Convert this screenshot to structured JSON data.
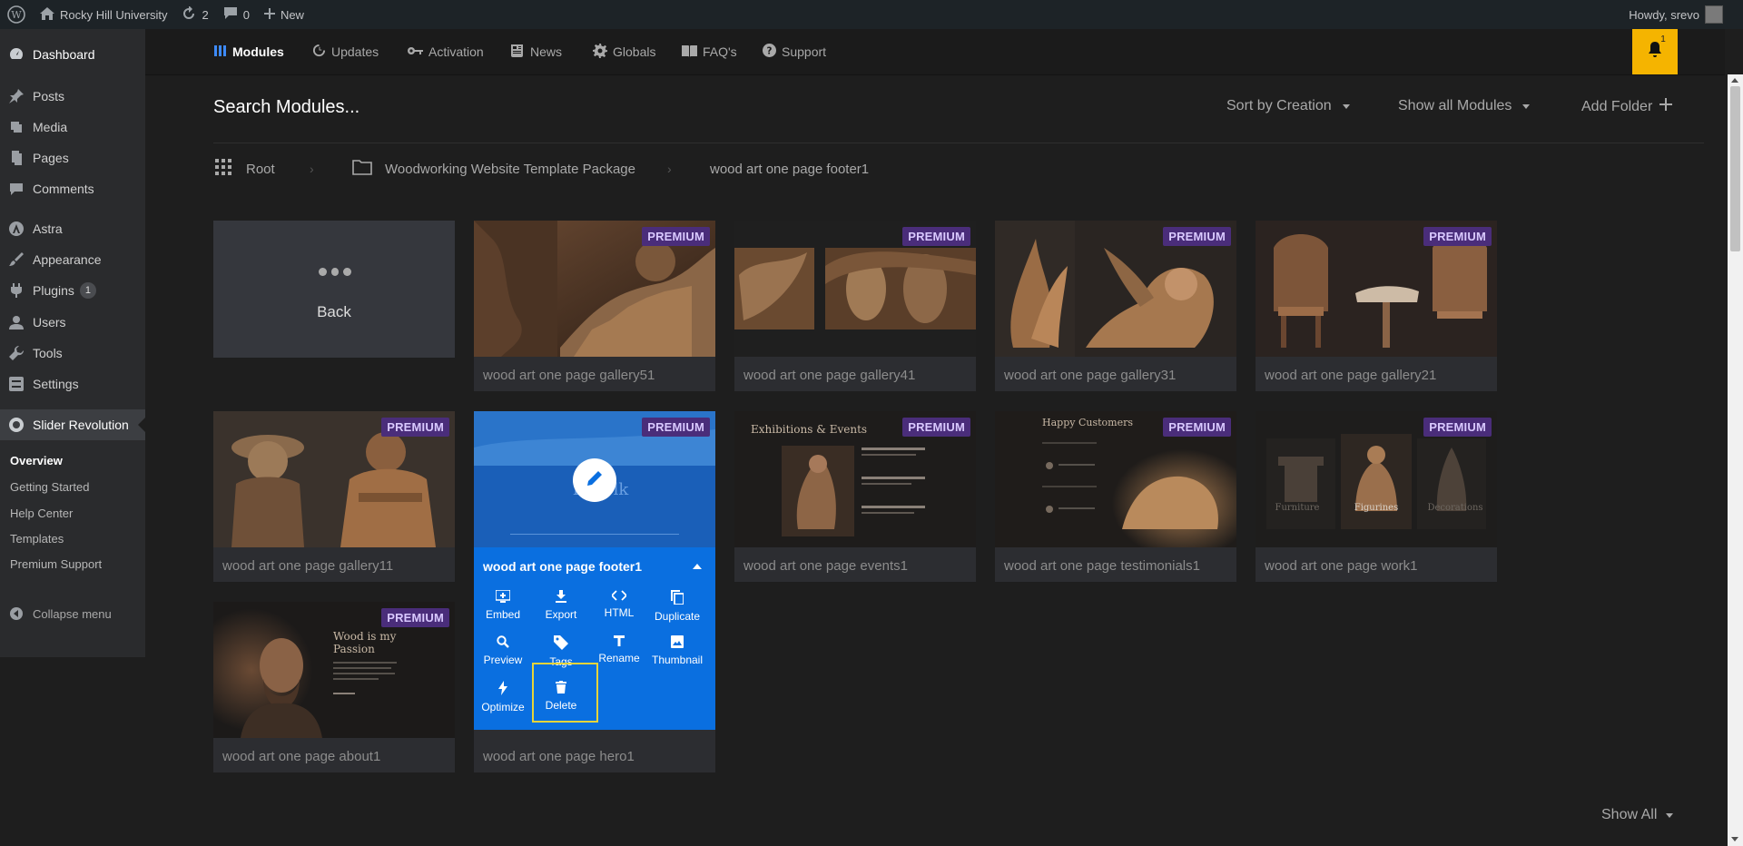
{
  "admin_bar": {
    "site_name": "Rocky Hill University",
    "updates_count": "2",
    "comments_count": "0",
    "new_label": "New",
    "howdy": "Howdy, srevo"
  },
  "sidebar": {
    "items": [
      {
        "label": "Dashboard",
        "icon": "dashboard-icon"
      },
      {
        "label": "Posts",
        "icon": "pin-icon"
      },
      {
        "label": "Media",
        "icon": "media-icon"
      },
      {
        "label": "Pages",
        "icon": "pages-icon"
      },
      {
        "label": "Comments",
        "icon": "comments-icon"
      },
      {
        "label": "Astra",
        "icon": "astra-icon"
      },
      {
        "label": "Appearance",
        "icon": "brush-icon"
      },
      {
        "label": "Plugins",
        "icon": "plugin-icon",
        "badge": "1"
      },
      {
        "label": "Users",
        "icon": "users-icon"
      },
      {
        "label": "Tools",
        "icon": "wrench-icon"
      },
      {
        "label": "Settings",
        "icon": "settings-icon"
      },
      {
        "label": "Slider Revolution",
        "icon": "revolution-icon"
      }
    ],
    "submenu": [
      "Overview",
      "Getting Started",
      "Help Center",
      "Templates",
      "Premium Support"
    ],
    "collapse_label": "Collapse menu"
  },
  "topnav": {
    "items": [
      "Modules",
      "Updates",
      "Activation",
      "News",
      "Globals",
      "FAQ's",
      "Support"
    ],
    "notification_count": "1",
    "accent_color": "#f5b400"
  },
  "toolbar": {
    "search_title": "Search Modules...",
    "sort_label": "Sort by Creation",
    "filter_label": "Show all Modules",
    "add_folder_label": "Add Folder"
  },
  "breadcrumb": {
    "root": "Root",
    "folder": "Woodworking Website Template Package",
    "current": "wood art one page footer1"
  },
  "back_label": "Back",
  "premium_label": "PREMIUM",
  "cards": [
    "wood art one page gallery51",
    "wood art one page gallery41",
    "wood art one page gallery31",
    "wood art one page gallery21",
    "wood art one page gallery11",
    "wood art one page events1",
    "wood art one page testimonials1",
    "wood art one page work1",
    "wood art one page about1"
  ],
  "thumb_text": {
    "events_heading": "Exhibitions & Events",
    "testimonials_heading": "Happy Customers",
    "work_labels": [
      "Furniture",
      "Figurines",
      "Decorations"
    ],
    "about_heading_1": "Wood is my",
    "about_heading_2": "Passion",
    "footer_partial": "Le",
    "footer_partial_2": "lk"
  },
  "selected_card": {
    "title": "wood art one page footer1",
    "actions": [
      "Embed",
      "Export",
      "HTML",
      "Duplicate",
      "Preview",
      "Tags",
      "Rename",
      "Thumbnail",
      "Optimize",
      "Delete"
    ],
    "color": "#0a6fe0"
  },
  "hero_label": "wood art one page hero1",
  "show_all_label": "Show All"
}
